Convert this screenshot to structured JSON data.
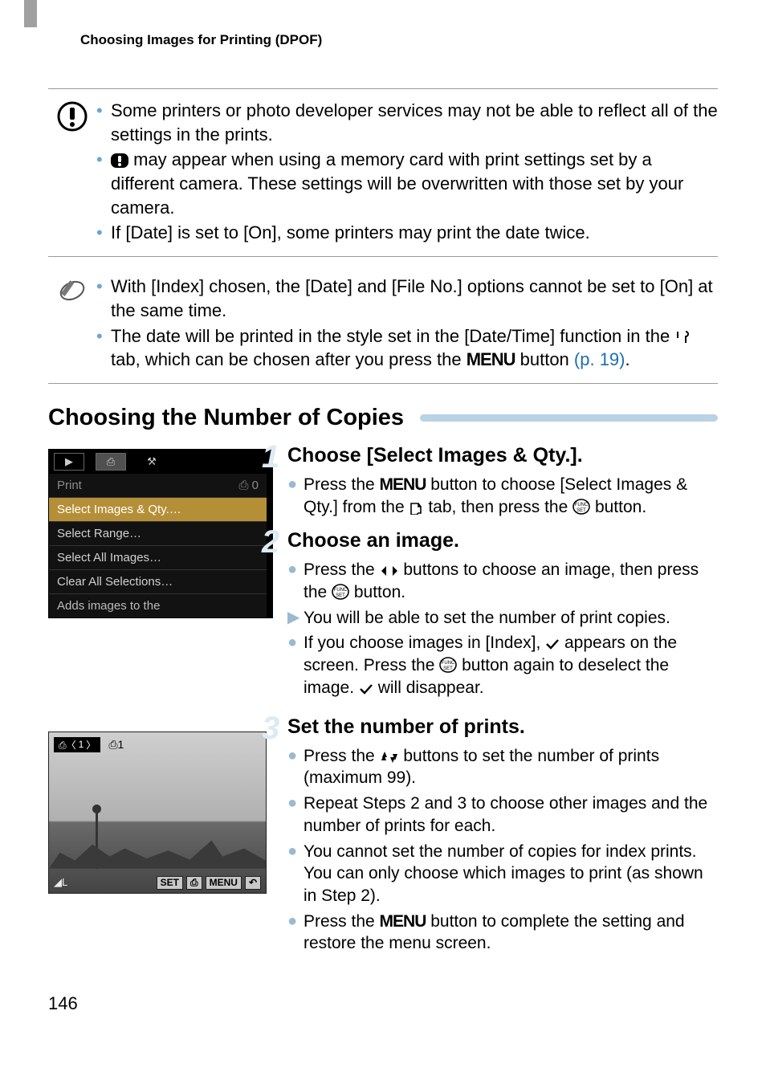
{
  "header": "Choosing Images for Printing (DPOF)",
  "caution": {
    "items": [
      "Some printers or photo developer services may not be able to reflect all of the settings in the prints.",
      {
        "pre": "",
        "post": " may appear when using a memory card with print settings set by a different camera. These settings will be overwritten with those set by your camera.",
        "has_info_icon": true
      },
      "If [Date] is set to [On], some printers may print the date twice."
    ]
  },
  "tip": {
    "items": [
      "With [Index] chosen, the [Date] and [File No.] options cannot be set to [On] at the same time.",
      {
        "t1": "The date will be printed in the style set in the [Date/Time] function in the ",
        "t2": " tab, which can be chosen after you press the ",
        "t3": " button ",
        "link": "(p. 19)",
        "t4": "."
      }
    ]
  },
  "section_title": "Choosing the Number of Copies",
  "cam_menu": {
    "title": "Print",
    "title_right": "⎙ 0",
    "rows": [
      "Select Images & Qty.…",
      "Select Range…",
      "Select All Images…",
      "Clear All Selections…"
    ],
    "hint": "Adds images to the"
  },
  "steps": {
    "s1": {
      "num": "1",
      "title": "Choose [Select Images & Qty.].",
      "body": [
        {
          "t1": "Press the ",
          "t2": " button to choose [Select Images & Qty.] from the ",
          "t3": " tab, then press the ",
          "t4": " button.",
          "icons": [
            "MENU",
            "print",
            "funcset"
          ]
        }
      ]
    },
    "s2": {
      "num": "2",
      "title": "Choose an image.",
      "body": [
        {
          "kind": "dot",
          "t1": "Press the ",
          "t2": " buttons to choose an image, then press the ",
          "t3": " button.",
          "icons": [
            "lr",
            "funcset"
          ]
        },
        {
          "kind": "arrow",
          "t": "You will be able to set the number of print copies."
        },
        {
          "kind": "dot",
          "t1": "If you choose images in [Index], ",
          "t2": " appears on the screen. Press the ",
          "t3": " button again to deselect the image. ",
          "t4": " will disappear.",
          "icons": [
            "check",
            "funcset",
            "check"
          ]
        }
      ]
    },
    "s3": {
      "num": "3",
      "title": "Set the number of prints.",
      "body": [
        {
          "kind": "dot",
          "t1": "Press the ",
          "t2": " buttons to set the number of prints (maximum 99).",
          "icons": [
            "ud"
          ]
        },
        {
          "kind": "dot",
          "t": "Repeat Steps 2 and 3 to choose other images and the number of prints for each."
        },
        {
          "kind": "dot",
          "t": "You cannot set the number of copies for index prints. You can only choose which images to print (as shown in Step 2)."
        },
        {
          "kind": "dot",
          "t1": "Press the ",
          "t2": " button to complete the setting and restore the menu screen.",
          "icons": [
            "MENU"
          ]
        }
      ]
    }
  },
  "photo_overlay": {
    "top_left_chip": "1",
    "top_left_copies": "⎙1",
    "bottom_left": "◢L",
    "bottom_set": "SET",
    "bottom_print": "⎙",
    "bottom_menu": "MENU",
    "bottom_back": "↶"
  },
  "page_number": "146"
}
